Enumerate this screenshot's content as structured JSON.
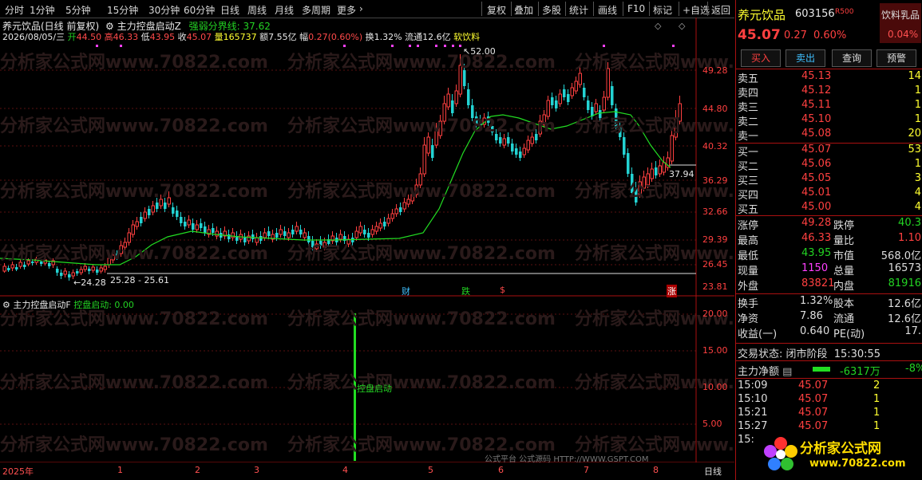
{
  "toolbar": {
    "tabs": [
      "分时",
      "1分钟",
      "5分钟",
      "15分钟",
      "30分钟",
      "60分钟",
      "日线",
      "周线",
      "月线",
      "多周期",
      "更多"
    ],
    "right_buttons": [
      "复权",
      "叠加",
      "多股",
      "统计",
      "画线",
      "F10",
      "标记",
      "+自选",
      "返回"
    ]
  },
  "header": {
    "title": "养元饮品(日线 前复权)",
    "indicator_name": "主力控盘启动Z",
    "indicator_label": "强弱分界线: 37.62",
    "date": "2026/08/05/三",
    "open_label": "开",
    "open": "44.50",
    "high_label": "高",
    "high": "46.33",
    "low_label": "低",
    "low": "43.95",
    "close_label": "收",
    "close": "45.07",
    "vol_label": "量",
    "vol": "165737",
    "amount_label": "额",
    "amount": "7.55亿",
    "change_label": "幅",
    "change": "0.27(0.60%)",
    "turnover_label": "换",
    "turnover": "1.32%",
    "float_label": "流通",
    "float": "12.6亿",
    "sector": "软饮料"
  },
  "main_axis": [
    "49.28",
    "44.80",
    "40.32",
    "36.29",
    "32.66",
    "29.39",
    "26.45",
    "23.81"
  ],
  "main_annotations": {
    "high_mark": "52.00",
    "low_mark": "24.28",
    "range_text": "25.28 - 25.61",
    "line_value": "37.94"
  },
  "event_marks": [
    "财",
    "跌",
    "$",
    "涨"
  ],
  "sub_panel": {
    "title": "主力控盘启动F",
    "value_label": "控盘启动: 0.00",
    "bar_label": "控盘启动",
    "axis": [
      "20.00",
      "15.00",
      "10.00",
      "5.00"
    ]
  },
  "x_axis": {
    "labels": [
      "2025年",
      "1",
      "2",
      "3",
      "4",
      "5",
      "6",
      "7",
      "8"
    ],
    "period": "日线"
  },
  "watermarks": [
    "分析家公式网www.70822.com",
    "公式平台 公式源码 HTTP://WWW.GSPT.COM"
  ],
  "stock_panel": {
    "name": "养元饮品",
    "code": "603156",
    "margin_flag": "R500",
    "sector_tag": "饮料乳品",
    "sector_change": "0.04%",
    "price": "45.07",
    "change": "0.27",
    "change_pct": "0.60%",
    "buttons": [
      "买入",
      "卖出",
      "查询",
      "预警"
    ],
    "asks": [
      {
        "label": "卖五",
        "price": "45.13",
        "vol": "14"
      },
      {
        "label": "卖四",
        "price": "45.12",
        "vol": "1"
      },
      {
        "label": "卖三",
        "price": "45.11",
        "vol": "1"
      },
      {
        "label": "卖二",
        "price": "45.10",
        "vol": "1"
      },
      {
        "label": "卖一",
        "price": "45.08",
        "vol": "20"
      }
    ],
    "bids": [
      {
        "label": "买一",
        "price": "45.07",
        "vol": "53"
      },
      {
        "label": "买二",
        "price": "45.06",
        "vol": "1"
      },
      {
        "label": "买三",
        "price": "45.05",
        "vol": "3"
      },
      {
        "label": "买四",
        "price": "45.01",
        "vol": "4"
      },
      {
        "label": "买五",
        "price": "45.00",
        "vol": "4"
      }
    ],
    "stats": [
      {
        "l1": "涨停",
        "v1": "49.28",
        "l2": "跌停",
        "v2": "40.3"
      },
      {
        "l1": "最高",
        "v1": "46.33",
        "l2": "量比",
        "v2": "1.10"
      },
      {
        "l1": "最低",
        "v1": "43.95",
        "l2": "市值",
        "v2": "568.0亿"
      },
      {
        "l1": "现量",
        "v1": "1150",
        "l2": "总量",
        "v2": "16573"
      },
      {
        "l1": "外盘",
        "v1": "83821",
        "l2": "内盘",
        "v2": "81916"
      }
    ],
    "stats2": [
      {
        "l1": "换手",
        "v1": "1.32%",
        "l2": "股本",
        "v2": "12.6亿"
      },
      {
        "l1": "净资",
        "v1": "7.86",
        "l2": "流通",
        "v2": "12.6亿"
      },
      {
        "l1": "收益(一)",
        "v1": "0.640",
        "l2": "PE(动)",
        "v2": "17."
      }
    ],
    "trade_state_label": "交易状态:",
    "trade_state": "闭市阶段",
    "trade_time": "15:30:55",
    "net_flow_label": "主力净额",
    "net_flow": "-6317万",
    "net_flow_pct": "-8%",
    "ticks": [
      {
        "time": "15:09",
        "price": "45.07",
        "vol": "2"
      },
      {
        "time": "15:10",
        "price": "45.07",
        "vol": "1"
      },
      {
        "time": "15:21",
        "price": "45.07",
        "vol": "1"
      },
      {
        "time": "15:27",
        "price": "45.07",
        "vol": "1"
      },
      {
        "time": "15:",
        "price": "",
        "vol": ""
      }
    ],
    "logo_text": "分析家公式网",
    "logo_url": "www.70822.com"
  }
}
